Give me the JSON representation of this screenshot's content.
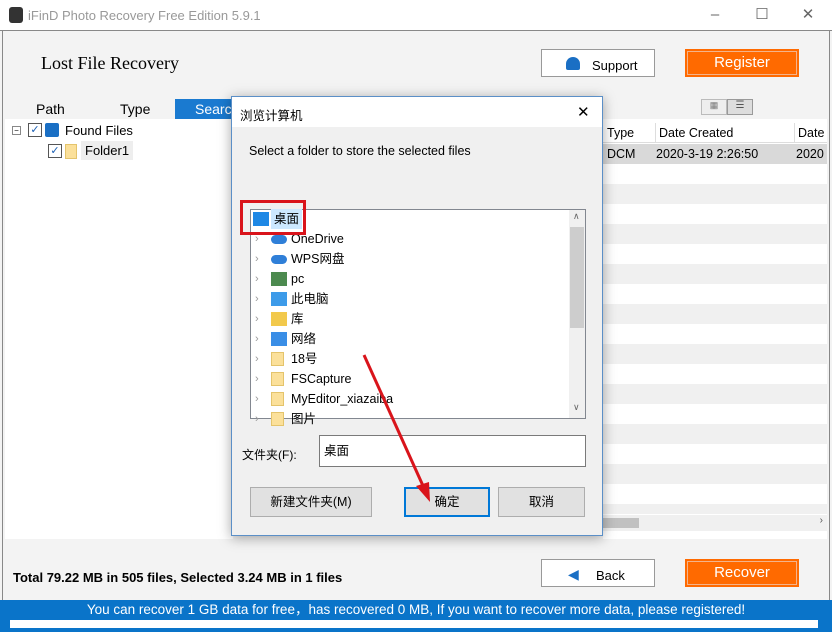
{
  "window": {
    "title": "iFinD Photo Recovery Free Edition 5.9.1",
    "minimize": "–",
    "maximize": "☐",
    "close": "✕"
  },
  "header": {
    "title": "Lost File Recovery",
    "support_label": "Support",
    "register_label": "Register"
  },
  "tabs": [
    {
      "label": "Path"
    },
    {
      "label": "Type"
    },
    {
      "label": "Searc"
    }
  ],
  "tree": {
    "root": "Found Files",
    "child": "Folder1"
  },
  "table": {
    "columns": [
      "Type",
      "Date Created",
      "Date"
    ],
    "rows": [
      [
        "DCM",
        "2020-3-19 2:26:50",
        "2020"
      ]
    ]
  },
  "footer": {
    "status": "Total 79.22 MB in 505 files,  Selected 3.24 MB in 1 files",
    "back_label": "Back",
    "recover_label": "Recover",
    "banner": "You can recover 1 GB data for free，has recovered 0 MB, If you want to recover more data, please registered!"
  },
  "dialog": {
    "title": "浏览计算机",
    "close": "✕",
    "prompt": "Select a folder to store the selected files",
    "items": [
      {
        "label": "桌面",
        "icon": "desktop-icon"
      },
      {
        "label": "OneDrive",
        "icon": "cloud-icon"
      },
      {
        "label": "WPS网盘",
        "icon": "cloud-icon"
      },
      {
        "label": "pc",
        "icon": "user-icon"
      },
      {
        "label": "此电脑",
        "icon": "computer-icon"
      },
      {
        "label": "库",
        "icon": "library-icon"
      },
      {
        "label": "网络",
        "icon": "network-icon"
      },
      {
        "label": "18号",
        "icon": "folder-icon"
      },
      {
        "label": "FSCapture",
        "icon": "folder-icon"
      },
      {
        "label": "MyEditor_xiazaiba",
        "icon": "folder-icon"
      },
      {
        "label": "图片",
        "icon": "folder-icon"
      }
    ],
    "folder_label": "文件夹(F):",
    "folder_value": "桌面",
    "new_folder_label": "新建文件夹(M)",
    "ok_label": "确定",
    "cancel_label": "取消"
  },
  "colors": {
    "accent": "#ff6a00",
    "brand_blue": "#0a74c9",
    "annotation_red": "#d9141b"
  }
}
